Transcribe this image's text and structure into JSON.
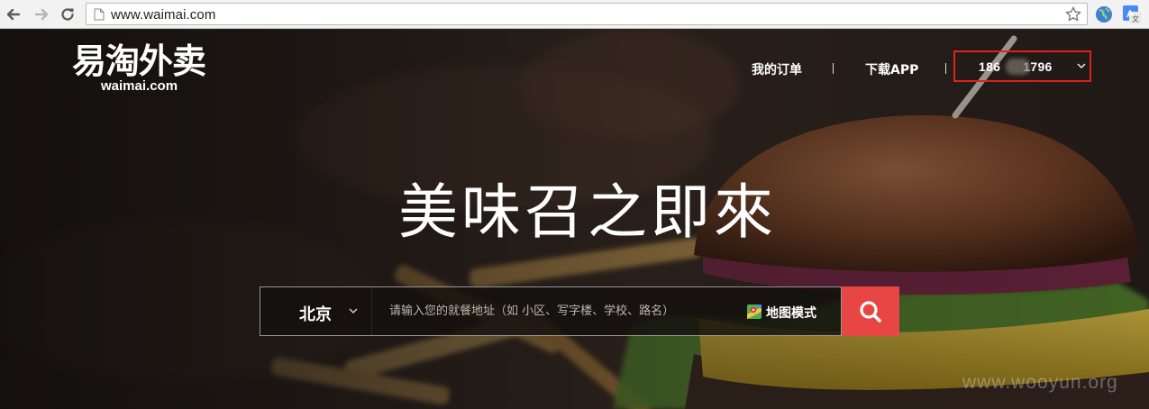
{
  "browser": {
    "url": "www.waimai.com",
    "icons": {
      "back": "arrow-left-icon",
      "forward": "arrow-right-icon",
      "reload": "reload-icon",
      "page": "page-icon",
      "bookmark": "star-icon",
      "extension_1": "globe-icon",
      "extension_2": "translate-icon"
    }
  },
  "header": {
    "logo_cn": "易淘外卖",
    "logo_en": "waimai.com",
    "nav": {
      "orders": "我的订单",
      "download": "下载APP"
    },
    "user": {
      "phone_start": "186",
      "phone_end": "1796"
    }
  },
  "hero": {
    "slogan": "美味召之即來"
  },
  "search": {
    "city": "北京",
    "placeholder": "请输入您的就餐地址（如 小区、写字楼、学校、路名）",
    "map_mode_label": "地图模式",
    "search_icon": "search-icon"
  },
  "watermark": "www.wooyun.org",
  "colors": {
    "accent_red": "#e84545",
    "highlight_box": "#e0201c",
    "chrome_bg": "#f2f2f2"
  }
}
